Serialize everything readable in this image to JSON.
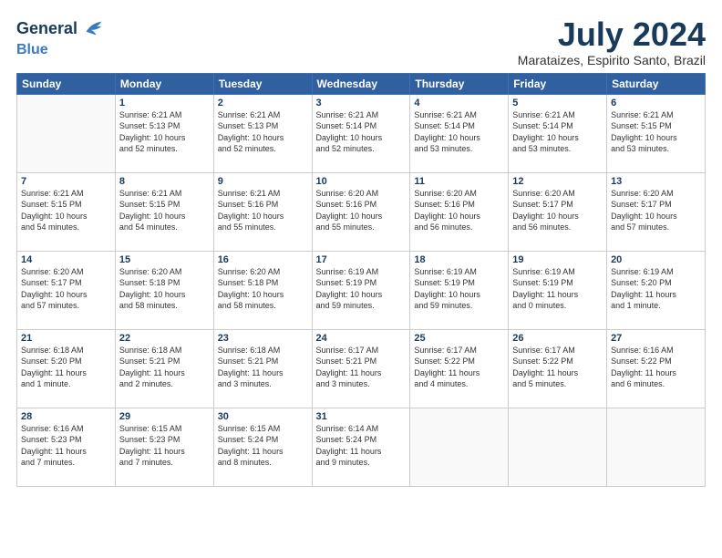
{
  "header": {
    "logo_line1": "General",
    "logo_line2": "Blue",
    "month_title": "July 2024",
    "subtitle": "Marataizes, Espirito Santo, Brazil"
  },
  "weekdays": [
    "Sunday",
    "Monday",
    "Tuesday",
    "Wednesday",
    "Thursday",
    "Friday",
    "Saturday"
  ],
  "weeks": [
    [
      {
        "day": "",
        "info": ""
      },
      {
        "day": "1",
        "info": "Sunrise: 6:21 AM\nSunset: 5:13 PM\nDaylight: 10 hours\nand 52 minutes."
      },
      {
        "day": "2",
        "info": "Sunrise: 6:21 AM\nSunset: 5:13 PM\nDaylight: 10 hours\nand 52 minutes."
      },
      {
        "day": "3",
        "info": "Sunrise: 6:21 AM\nSunset: 5:14 PM\nDaylight: 10 hours\nand 52 minutes."
      },
      {
        "day": "4",
        "info": "Sunrise: 6:21 AM\nSunset: 5:14 PM\nDaylight: 10 hours\nand 53 minutes."
      },
      {
        "day": "5",
        "info": "Sunrise: 6:21 AM\nSunset: 5:14 PM\nDaylight: 10 hours\nand 53 minutes."
      },
      {
        "day": "6",
        "info": "Sunrise: 6:21 AM\nSunset: 5:15 PM\nDaylight: 10 hours\nand 53 minutes."
      }
    ],
    [
      {
        "day": "7",
        "info": "Sunrise: 6:21 AM\nSunset: 5:15 PM\nDaylight: 10 hours\nand 54 minutes."
      },
      {
        "day": "8",
        "info": "Sunrise: 6:21 AM\nSunset: 5:15 PM\nDaylight: 10 hours\nand 54 minutes."
      },
      {
        "day": "9",
        "info": "Sunrise: 6:21 AM\nSunset: 5:16 PM\nDaylight: 10 hours\nand 55 minutes."
      },
      {
        "day": "10",
        "info": "Sunrise: 6:20 AM\nSunset: 5:16 PM\nDaylight: 10 hours\nand 55 minutes."
      },
      {
        "day": "11",
        "info": "Sunrise: 6:20 AM\nSunset: 5:16 PM\nDaylight: 10 hours\nand 56 minutes."
      },
      {
        "day": "12",
        "info": "Sunrise: 6:20 AM\nSunset: 5:17 PM\nDaylight: 10 hours\nand 56 minutes."
      },
      {
        "day": "13",
        "info": "Sunrise: 6:20 AM\nSunset: 5:17 PM\nDaylight: 10 hours\nand 57 minutes."
      }
    ],
    [
      {
        "day": "14",
        "info": "Sunrise: 6:20 AM\nSunset: 5:17 PM\nDaylight: 10 hours\nand 57 minutes."
      },
      {
        "day": "15",
        "info": "Sunrise: 6:20 AM\nSunset: 5:18 PM\nDaylight: 10 hours\nand 58 minutes."
      },
      {
        "day": "16",
        "info": "Sunrise: 6:20 AM\nSunset: 5:18 PM\nDaylight: 10 hours\nand 58 minutes."
      },
      {
        "day": "17",
        "info": "Sunrise: 6:19 AM\nSunset: 5:19 PM\nDaylight: 10 hours\nand 59 minutes."
      },
      {
        "day": "18",
        "info": "Sunrise: 6:19 AM\nSunset: 5:19 PM\nDaylight: 10 hours\nand 59 minutes."
      },
      {
        "day": "19",
        "info": "Sunrise: 6:19 AM\nSunset: 5:19 PM\nDaylight: 11 hours\nand 0 minutes."
      },
      {
        "day": "20",
        "info": "Sunrise: 6:19 AM\nSunset: 5:20 PM\nDaylight: 11 hours\nand 1 minute."
      }
    ],
    [
      {
        "day": "21",
        "info": "Sunrise: 6:18 AM\nSunset: 5:20 PM\nDaylight: 11 hours\nand 1 minute."
      },
      {
        "day": "22",
        "info": "Sunrise: 6:18 AM\nSunset: 5:21 PM\nDaylight: 11 hours\nand 2 minutes."
      },
      {
        "day": "23",
        "info": "Sunrise: 6:18 AM\nSunset: 5:21 PM\nDaylight: 11 hours\nand 3 minutes."
      },
      {
        "day": "24",
        "info": "Sunrise: 6:17 AM\nSunset: 5:21 PM\nDaylight: 11 hours\nand 3 minutes."
      },
      {
        "day": "25",
        "info": "Sunrise: 6:17 AM\nSunset: 5:22 PM\nDaylight: 11 hours\nand 4 minutes."
      },
      {
        "day": "26",
        "info": "Sunrise: 6:17 AM\nSunset: 5:22 PM\nDaylight: 11 hours\nand 5 minutes."
      },
      {
        "day": "27",
        "info": "Sunrise: 6:16 AM\nSunset: 5:22 PM\nDaylight: 11 hours\nand 6 minutes."
      }
    ],
    [
      {
        "day": "28",
        "info": "Sunrise: 6:16 AM\nSunset: 5:23 PM\nDaylight: 11 hours\nand 7 minutes."
      },
      {
        "day": "29",
        "info": "Sunrise: 6:15 AM\nSunset: 5:23 PM\nDaylight: 11 hours\nand 7 minutes."
      },
      {
        "day": "30",
        "info": "Sunrise: 6:15 AM\nSunset: 5:24 PM\nDaylight: 11 hours\nand 8 minutes."
      },
      {
        "day": "31",
        "info": "Sunrise: 6:14 AM\nSunset: 5:24 PM\nDaylight: 11 hours\nand 9 minutes."
      },
      {
        "day": "",
        "info": ""
      },
      {
        "day": "",
        "info": ""
      },
      {
        "day": "",
        "info": ""
      }
    ]
  ]
}
